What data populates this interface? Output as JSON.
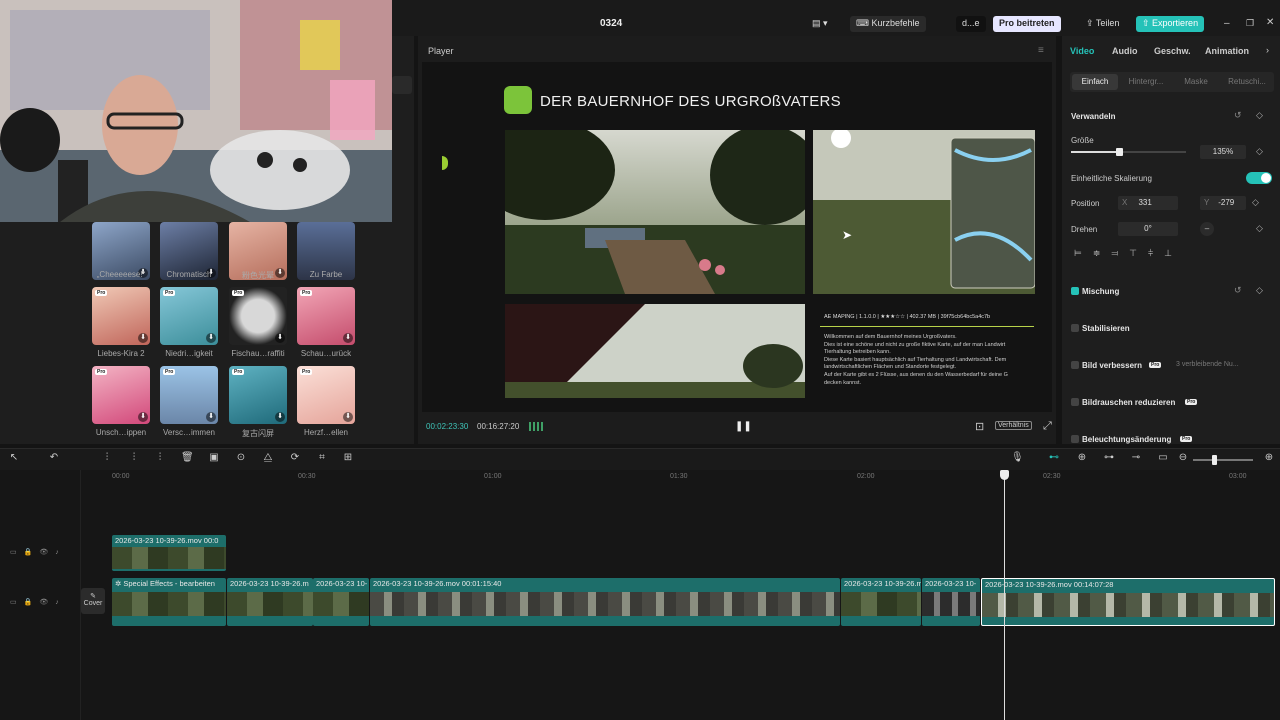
{
  "topbar": {
    "project_title": "0324",
    "shortcuts_label": "Kurzbefehle",
    "trimmed_button": "d...e",
    "pro_edit_label": "Pro beitreten",
    "share_label": "Teilen",
    "export_label": "Exportieren"
  },
  "media": {
    "items": [
      {
        "label": "„Cheeeeese!“"
      },
      {
        "label": "Chromatisch"
      },
      {
        "label": "粉色光晕"
      },
      {
        "label": "Zu Farbe"
      },
      {
        "label": "Liebes-Kira 2"
      },
      {
        "label": "Niedri…igkeit"
      },
      {
        "label": "Fischau…raffiti"
      },
      {
        "label": "Schau…urück"
      },
      {
        "label": "Unsch…ippen"
      },
      {
        "label": "Versc…immen"
      },
      {
        "label": "复古闪屏"
      },
      {
        "label": "Herzf…ellen"
      }
    ],
    "pro_badge": "Pro"
  },
  "player": {
    "header": "Player",
    "content_title": "DER BAUERNHOF DES URGROßVATERS",
    "info_header": "AE MAPING  |  1.1.0.0  |  ★★★☆☆  |  402.37 MB  |  39f75cb64bc5a4c7b",
    "description_lines": [
      "Willkommen auf dem Bauernhof meines Urgroßvaters.",
      "Dies ist eine schöne und nicht zu große fiktive Karte, auf der man Landwirt",
      "Tierhaltung betreiben kann.",
      "Diese Karte basiert hauptsächlich auf Tierhaltung und Landwirtschaft. Dem",
      "landwirtschaftlichen Flächen und Standorte festgelegt.",
      "Auf der Karte gibt es 2 Flüsse, aus denen du den Wasserbedarf für deine G",
      "decken kannst."
    ],
    "time_current": "00:02:23:30",
    "time_total": "00:16:27:20",
    "ratio_label": "Verhältnis"
  },
  "inspector": {
    "tabs": [
      "Video",
      "Audio",
      "Geschw.",
      "Animation"
    ],
    "subtabs": [
      "Einfach",
      "Hintergr...",
      "Maske",
      "Retuschi..."
    ],
    "transform_title": "Verwandeln",
    "size_label": "Größe",
    "size_value": "135%",
    "size_fraction": 0.42,
    "uniform_label": "Einheitliche Skalierung",
    "position_label": "Position",
    "pos_x_axis": "X",
    "pos_x": "331",
    "pos_y_axis": "Y",
    "pos_y": "-279",
    "rotate_label": "Drehen",
    "rotate_value": "0°",
    "mix_title": "Mischung",
    "stabilize_title": "Stabilisieren",
    "enhance_title": "Bild verbessern",
    "enhance_note": "3 verbleibende Nu...",
    "denoise_title": "Bildrauschen reduzieren",
    "lighting_title": "Beleuchtungsänderung",
    "accent": "#25c2b8"
  },
  "timeline": {
    "ruler": [
      "00:00",
      "00:30",
      "01:00",
      "01:30",
      "02:00",
      "02:30",
      "03:00"
    ],
    "upper_clip": "2026-03-23 10-39-26.mov  00:0",
    "cover_label": "Cover",
    "main_clips": [
      "Special Effects - bearbeiten",
      "2026-03-23 10-39-26.m",
      "2026-03-23 10-",
      "2026-03-23 10-39-26.mov  00:01:15:40",
      "2026-03-23 10-39-26.m",
      "2026-03-23 10-",
      "2026-03-23 10-39-26.mov  00:14:07:28"
    ]
  }
}
